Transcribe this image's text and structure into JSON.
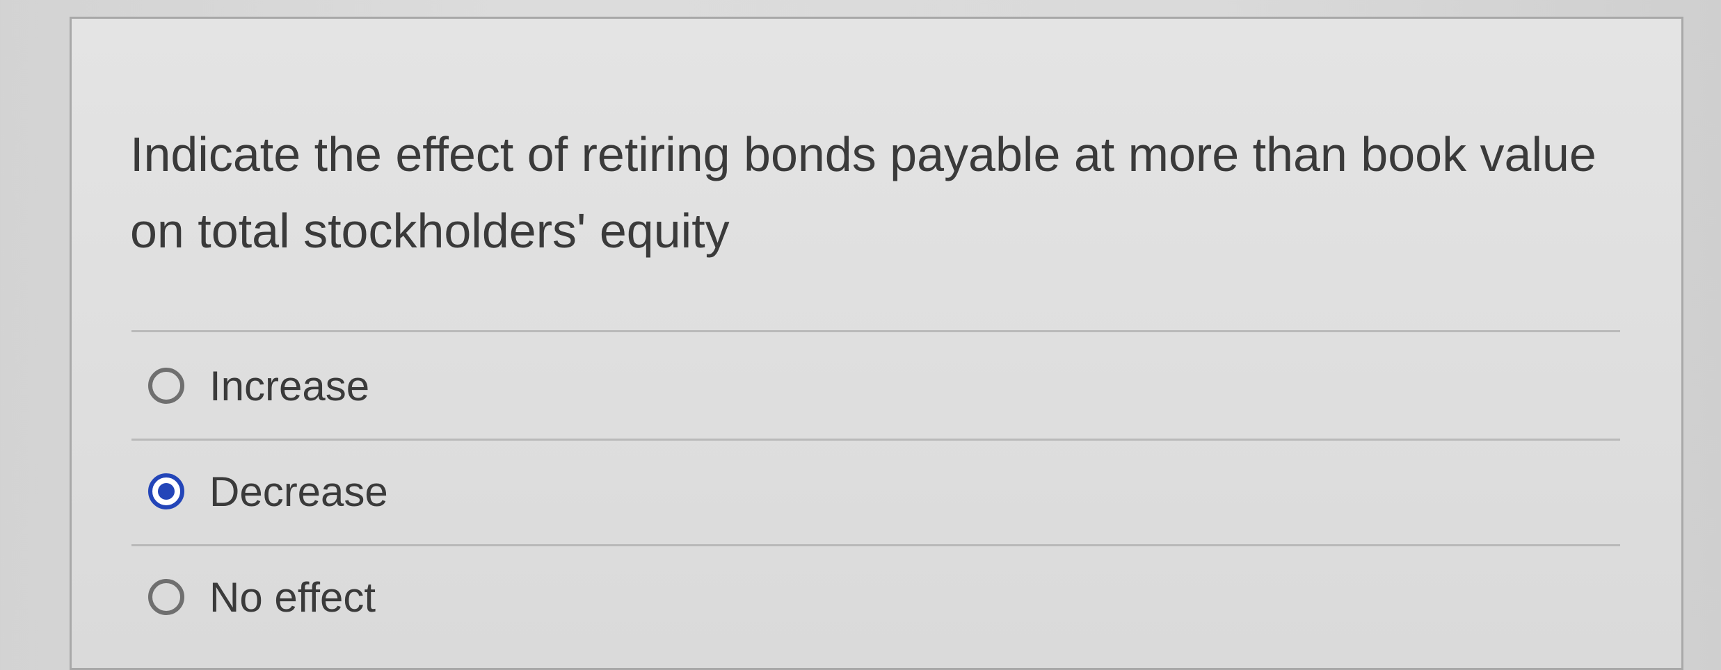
{
  "question": {
    "line1": "Indicate the effect of retiring bonds payable at more than book value",
    "line2": "on total stockholders' equity"
  },
  "options": [
    {
      "label": "Increase",
      "selected": false
    },
    {
      "label": "Decrease",
      "selected": true
    },
    {
      "label": "No effect",
      "selected": false
    }
  ],
  "colors": {
    "selected_radio": "#2345b8",
    "unselected_radio": "#6f6f6f",
    "text": "#3a3a3a"
  }
}
